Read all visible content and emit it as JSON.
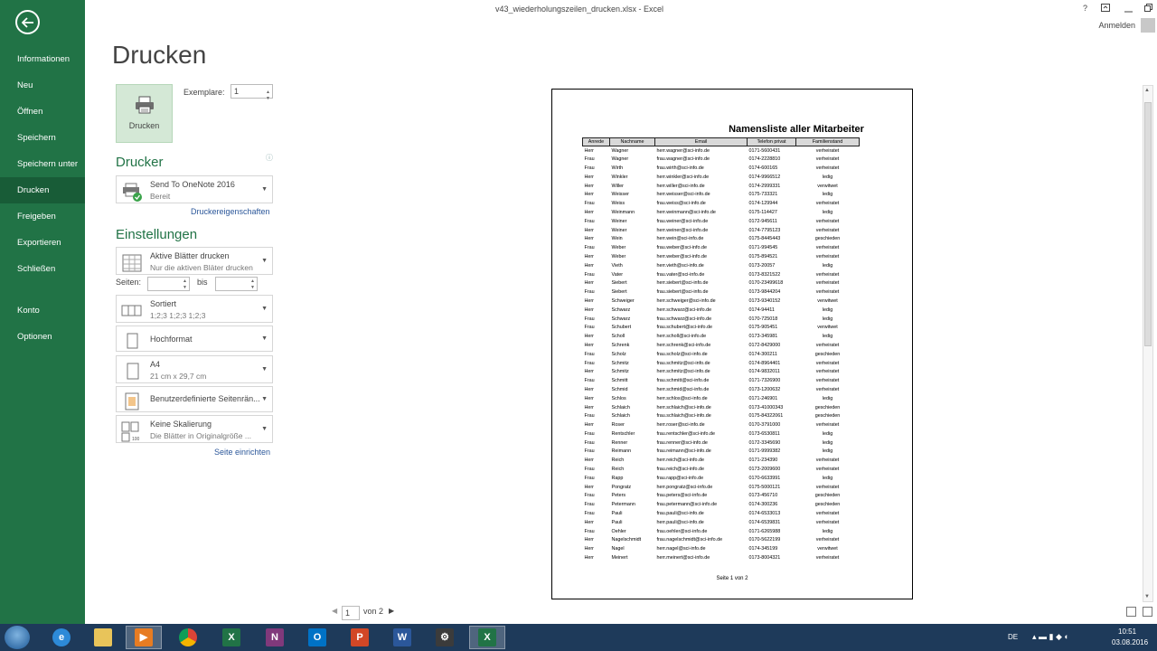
{
  "window": {
    "title": "v43_wiederholungszeilen_drucken.xlsx - Excel",
    "help": "?",
    "signin": "Anmelden"
  },
  "sidebar": {
    "items": [
      {
        "label": "Informationen"
      },
      {
        "label": "Neu"
      },
      {
        "label": "Öffnen"
      },
      {
        "label": "Speichern"
      },
      {
        "label": "Speichern unter"
      },
      {
        "label": "Drucken"
      },
      {
        "label": "Freigeben"
      },
      {
        "label": "Exportieren"
      },
      {
        "label": "Schließen"
      },
      {
        "label": "Konto"
      },
      {
        "label": "Optionen"
      }
    ]
  },
  "print": {
    "title": "Drucken",
    "button_label": "Drucken",
    "copies_label": "Exemplare:",
    "copies_value": "1",
    "printer_heading": "Drucker",
    "printer_name": "Send To OneNote 2016",
    "printer_status": "Bereit",
    "printer_properties": "Druckereigenschaften",
    "settings_heading": "Einstellungen",
    "what": {
      "t1": "Aktive Blätter drucken",
      "t2": "Nur die aktiven Bläter drucken"
    },
    "pages_label": "Seiten:",
    "pages_to": "bis",
    "collate": {
      "t1": "Sortiert",
      "t2": "1;2;3    1;2;3    1;2;3"
    },
    "orientation": {
      "t1": "Hochformat"
    },
    "paper": {
      "t1": "A4",
      "t2": "21  cm x 29,7  cm"
    },
    "margins": {
      "t1": "Benutzerdefinierte Seitenrän..."
    },
    "scaling": {
      "t1": "Keine Skalierung",
      "t2": "Die Blätter in Originalgröße ..."
    },
    "page_setup": "Seite einrichten"
  },
  "preview": {
    "sheet_title": "Namensliste aller Mitarbeiter",
    "columns": [
      "Anrede",
      "Nachname",
      "Email",
      "Telefon privat",
      "Familienstand"
    ],
    "rows": [
      [
        "Herr",
        "Wagner",
        "herr.wagner@sci-info.de",
        "0171-5600431",
        "verheiratet"
      ],
      [
        "Frau",
        "Wagner",
        "frau.wagner@sci-info.de",
        "0174-2228810",
        "verheiratet"
      ],
      [
        "Frau",
        "Wirth",
        "frau.wirth@sci-info.de",
        "0174-600165",
        "verheiratet"
      ],
      [
        "Herr",
        "Winkler",
        "herr.winkler@sci-info.de",
        "0174-9966512",
        "ledig"
      ],
      [
        "Herr",
        "Willer",
        "herr.willer@sci-info.de",
        "0174-2999331",
        "verwitwet"
      ],
      [
        "Herr",
        "Weisser",
        "herr.weisser@sci-info.de",
        "0175-733321",
        "ledig"
      ],
      [
        "Frau",
        "Weiss",
        "frau.weiss@sci-info.de",
        "0174-129944",
        "verheiratet"
      ],
      [
        "Herr",
        "Weinmann",
        "herr.weinmann@sci-info.de",
        "0175-114427",
        "ledig"
      ],
      [
        "Frau",
        "Weiner",
        "frau.weiner@sci-info.de",
        "0172-945611",
        "verheiratet"
      ],
      [
        "Herr",
        "Weiner",
        "herr.weiner@sci-info.de",
        "0174-7795123",
        "verheiratet"
      ],
      [
        "Herr",
        "Wein",
        "herr.wein@sci-info.de",
        "0175-8445443",
        "geschieden"
      ],
      [
        "Frau",
        "Weber",
        "frau.weber@sci-info.de",
        "0171-994545",
        "verheiratet"
      ],
      [
        "Herr",
        "Weber",
        "herr.weber@sci-info.de",
        "0175-894521",
        "verheiratet"
      ],
      [
        "Herr",
        "Vieth",
        "herr.vieth@sci-info.de",
        "0173-20057",
        "ledig"
      ],
      [
        "Frau",
        "Vater",
        "frau.vater@sci-info.de",
        "0173-8321522",
        "verheiratet"
      ],
      [
        "Herr",
        "Siebert",
        "herr.siebert@sci-info.de",
        "0170-23499618",
        "verheiratet"
      ],
      [
        "Frau",
        "Siebert",
        "frau.siebert@sci-info.de",
        "0173-9844204",
        "verheiratet"
      ],
      [
        "Herr",
        "Schweiger",
        "herr.schweiger@sci-info.de",
        "0173-9340152",
        "verwitwet"
      ],
      [
        "Herr",
        "Schwarz",
        "herr.schwarz@sci-info.de",
        "0174-94411",
        "ledig"
      ],
      [
        "Frau",
        "Schwarz",
        "frau.schwarz@sci-info.de",
        "0170-725018",
        "ledig"
      ],
      [
        "Frau",
        "Schubert",
        "frau.schubert@sci-info.de",
        "0175-905451",
        "verwitwet"
      ],
      [
        "Herr",
        "Scholl",
        "herr.scholl@sci-info.de",
        "0173-345981",
        "ledig"
      ],
      [
        "Herr",
        "Schrenk",
        "herr.schrenk@sci-info.de",
        "0172-8429000",
        "verheiratet"
      ],
      [
        "Frau",
        "Scholz",
        "frau.scholz@sci-info.de",
        "0174-300211",
        "geschieden"
      ],
      [
        "Frau",
        "Schmitz",
        "frau.schmitz@sci-info.de",
        "0174-8964401",
        "verheiratet"
      ],
      [
        "Herr",
        "Schmitz",
        "herr.schmitz@sci-info.de",
        "0174-9832011",
        "verheiratet"
      ],
      [
        "Frau",
        "Schmitt",
        "frau.schmitt@sci-info.de",
        "0171-7326900",
        "verheiratet"
      ],
      [
        "Herr",
        "Schmid",
        "herr.schmid@sci-info.de",
        "0173-1200632",
        "verheiratet"
      ],
      [
        "Herr",
        "Schlos",
        "herr.schlos@sci-info.de",
        "0171-246901",
        "ledig"
      ],
      [
        "Herr",
        "Schlaich",
        "herr.schlaich@sci-info.de",
        "0173-41000343",
        "geschieden"
      ],
      [
        "Frau",
        "Schlaich",
        "frau.schlaich@sci-info.de",
        "0175-84322061",
        "geschieden"
      ],
      [
        "Herr",
        "Roser",
        "herr.roser@sci-info.de",
        "0170-3791000",
        "verheiratet"
      ],
      [
        "Frau",
        "Rentschler",
        "frau.rentschler@sci-info.de",
        "0173-6530811",
        "ledig"
      ],
      [
        "Frau",
        "Renner",
        "frau.renner@sci-info.de",
        "0172-3345690",
        "ledig"
      ],
      [
        "Frau",
        "Reimann",
        "frau.reimann@sci-info.de",
        "0171-9999382",
        "ledig"
      ],
      [
        "Herr",
        "Reich",
        "herr.reich@sci-info.de",
        "0171-234390",
        "verheiratet"
      ],
      [
        "Frau",
        "Reich",
        "frau.reich@sci-info.de",
        "0173-2009600",
        "verheiratet"
      ],
      [
        "Frau",
        "Rapp",
        "frau.rapp@sci-info.de",
        "0170-6633991",
        "ledig"
      ],
      [
        "Herr",
        "Pongratz",
        "herr.pongratz@sci-info.de",
        "0175-5000121",
        "verheiratet"
      ],
      [
        "Frau",
        "Peters",
        "frau.peters@sci-info.de",
        "0173-456710",
        "geschieden"
      ],
      [
        "Frau",
        "Petermann",
        "frau.petermann@sci-info.de",
        "0174-300236",
        "geschieden"
      ],
      [
        "Frau",
        "Pauli",
        "frau.pauli@sci-info.de",
        "0174-6533013",
        "verheiratet"
      ],
      [
        "Herr",
        "Pauli",
        "herr.pauli@sci-info.de",
        "0174-6539831",
        "verheiratet"
      ],
      [
        "Frau",
        "Oehler",
        "frau.oehler@sci-info.de",
        "0171-6265988",
        "ledig"
      ],
      [
        "Herr",
        "Nagelschmidt",
        "frau.nagelschmidt@sci-info.de",
        "0170-5622199",
        "verheiratet"
      ],
      [
        "Herr",
        "Nagel",
        "herr.nagel@sci-info.de",
        "0174-345199",
        "verwitwet"
      ],
      [
        "Herr",
        "Meinert",
        "herr.meinert@sci-info.de",
        "0173-8004321",
        "verheiratet"
      ]
    ],
    "footer": "Seite 1 von 2"
  },
  "page_nav": {
    "current": "1",
    "of": "von 2"
  },
  "tray": {
    "lang": "DE",
    "time": "10:51",
    "date": "03.08.2016"
  },
  "colors": {
    "excel_green": "#217346",
    "excel_green_dark": "#185c37",
    "accent_link": "#2b579a",
    "taskbar": "#1e3a5a"
  }
}
